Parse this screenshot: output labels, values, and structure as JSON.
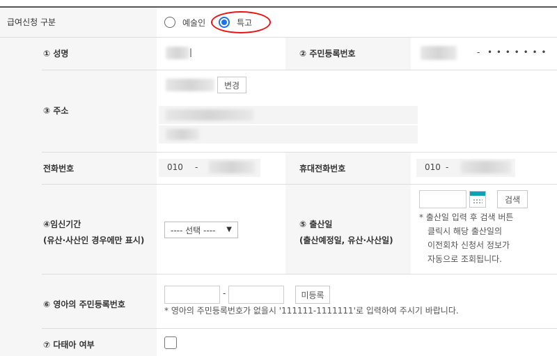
{
  "benefit_type": {
    "label": "급여신청 구분",
    "options": [
      {
        "label": "예술인",
        "selected": false
      },
      {
        "label": "특고",
        "selected": true
      }
    ]
  },
  "name": {
    "label": "① 성명",
    "value_tail": "|"
  },
  "rrn": {
    "label": "② 주민등록번호",
    "separator": "-",
    "masked_back": "• • • • • • •"
  },
  "address": {
    "label": "③ 주소",
    "change_button": "변경"
  },
  "phone": {
    "label": "전화번호",
    "prefix": "010",
    "separator": "-"
  },
  "mobile": {
    "label": "휴대전화번호",
    "prefix": "010",
    "separator": "-"
  },
  "pregnancy": {
    "label_line1": "④임신기간",
    "label_line2": "(유산·사산인 경우에만 표시)",
    "select_value": "---- 선택 ----"
  },
  "birth_date": {
    "label_line1": "⑤ 출산일",
    "label_line2": "(출산예정일, 유산·사산일)",
    "search_button": "검색",
    "note_lines": [
      "* 출산일 입력 후 검색 버튼",
      "클릭시 해당 출산일의",
      "이전회차 신청서 정보가",
      "자동으로 조회됩니다."
    ]
  },
  "infant_rrn": {
    "label": "⑥ 영아의 주민등록번호",
    "separator": "-",
    "unregistered_button": "미등록",
    "note": "* 영아의 주민등록번호가 없을시 '111111-1111111'로 입력하여 주시기 바랍니다."
  },
  "multiple_birth": {
    "label": "⑦ 다태아 여부"
  },
  "colors": {
    "accent": "#1a73e8",
    "highlight": "#e11111",
    "label_bg": "#f6f6f6"
  }
}
